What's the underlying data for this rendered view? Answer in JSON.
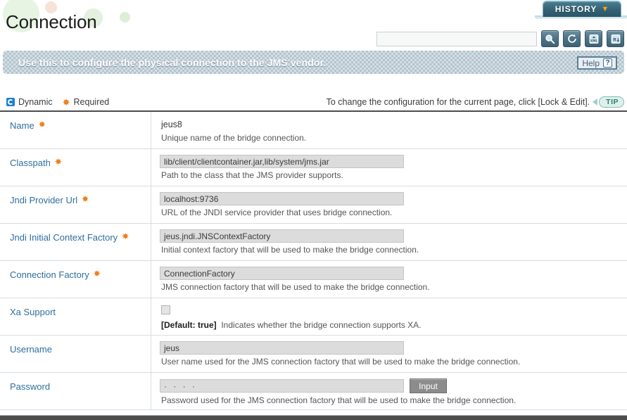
{
  "header": {
    "title": "Connection",
    "history_label": "HISTORY",
    "history_chevron": "chevron-down-icon"
  },
  "toolbar": {
    "search_value": "",
    "search_placeholder": "",
    "buttons": [
      {
        "name": "search-icon",
        "title": "Search"
      },
      {
        "name": "refresh-icon",
        "title": "Refresh"
      },
      {
        "name": "export-xml-icon",
        "title": "Export XML"
      },
      {
        "name": "export-report-icon",
        "title": "Export Report"
      }
    ]
  },
  "banner": {
    "text": "Use this to configure the physical connection to the JMS vendor.",
    "help_label": "Help",
    "help_mark": "?"
  },
  "legend": {
    "dynamic_label": "Dynamic",
    "required_label": "Required",
    "required_mark": "✸",
    "hint": "To change the configuration for the current page, click [Lock & Edit].",
    "tip_label": "TIP"
  },
  "form": {
    "rows": [
      {
        "label": "Name",
        "required": true,
        "control": "text",
        "value": "jeus8",
        "desc": "Unique name of the bridge connection."
      },
      {
        "label": "Classpath",
        "required": true,
        "control": "input",
        "value": "lib/client/clientcontainer.jar,lib/system/jms.jar",
        "desc": "Path to the class that the JMS provider supports."
      },
      {
        "label": "Jndi Provider Url",
        "required": true,
        "control": "input",
        "value": "localhost:9736",
        "desc": "URL of the JNDI service provider that uses bridge connection."
      },
      {
        "label": "Jndi Initial Context Factory",
        "required": true,
        "control": "input",
        "value": "jeus.jndi.JNSContextFactory",
        "desc": "Initial context factory that will be used to make the bridge connection."
      },
      {
        "label": "Connection Factory",
        "required": true,
        "control": "input",
        "value": "ConnectionFactory",
        "desc": "JMS connection factory that will be used to make the bridge connection."
      },
      {
        "label": "Xa Support",
        "required": false,
        "control": "checkbox",
        "checked": false,
        "default_text": "[Default: true]",
        "desc": "Indicates whether the bridge connection supports XA."
      },
      {
        "label": "Username",
        "required": false,
        "control": "input",
        "value": "jeus",
        "desc": "User name used for the JMS connection factory that will be used to make the bridge connection."
      },
      {
        "label": "Password",
        "required": false,
        "control": "password",
        "value": "· · · ·",
        "button_label": "Input",
        "desc": "Password used for the JMS connection factory that will be used to make the bridge connection."
      }
    ]
  },
  "colors": {
    "accent_blue": "#2e6f9e",
    "required_orange": "#f07f1a",
    "banner_bg": "#b3c4ce",
    "history_tab": "#336274",
    "tip_green": "#2d7f70"
  }
}
